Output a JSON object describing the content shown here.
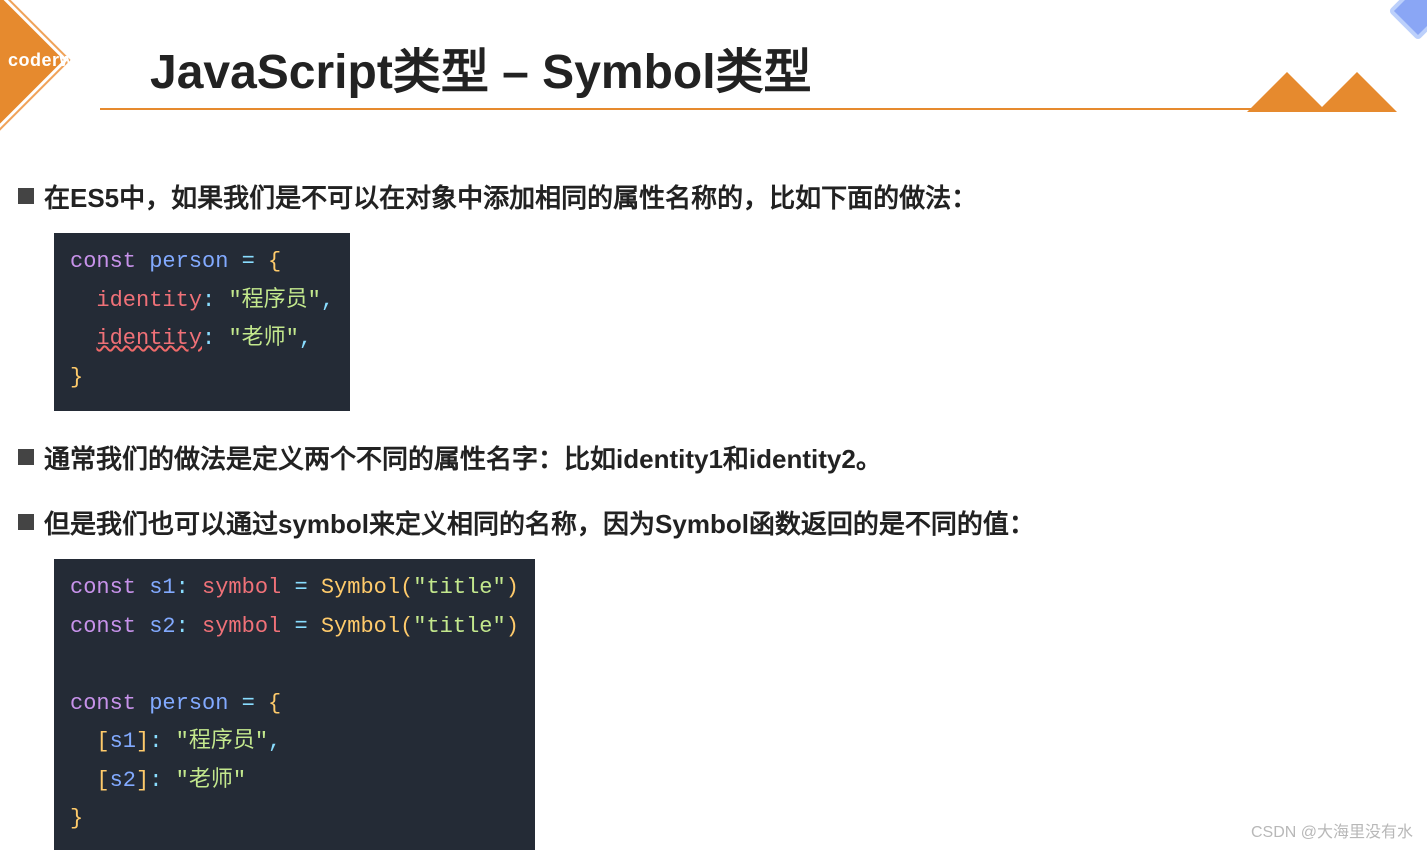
{
  "logo": {
    "text": "coderwhy"
  },
  "title": "JavaScript类型 – Symbol类型",
  "bullets": {
    "b1": "在ES5中，如果我们是不可以在对象中添加相同的属性名称的，比如下面的做法：",
    "b2": "通常我们的做法是定义两个不同的属性名字：比如identity1和identity2。",
    "b3": "但是我们也可以通过symbol来定义相同的名称，因为Symbol函数返回的是不同的值："
  },
  "code1": {
    "kw_const": "const",
    "person": "person",
    "eq": " = ",
    "lbrace": "{",
    "rbrace": "}",
    "indent": "  ",
    "dot": "·",
    "identity": "identity",
    "colon_sp": ": ",
    "val1": "\"程序员\"",
    "val2": "\"老师\"",
    "comma": ","
  },
  "code2": {
    "kw_const": "const",
    "s1": "s1",
    "s2": "s2",
    "type_colon": ": ",
    "symbol_type": "symbol",
    "eq": " = ",
    "Symbol": "Symbol",
    "paren_open": "(",
    "paren_close": ")",
    "title_str": "\"title\"",
    "person": "person",
    "lbrace": "{",
    "rbrace": "}",
    "br_open": "[",
    "br_close": "]",
    "colon_sp": ": ",
    "val1": "\"程序员\"",
    "val2": "\"老师\"",
    "comma": ","
  },
  "watermark": "CSDN @大海里没有水"
}
